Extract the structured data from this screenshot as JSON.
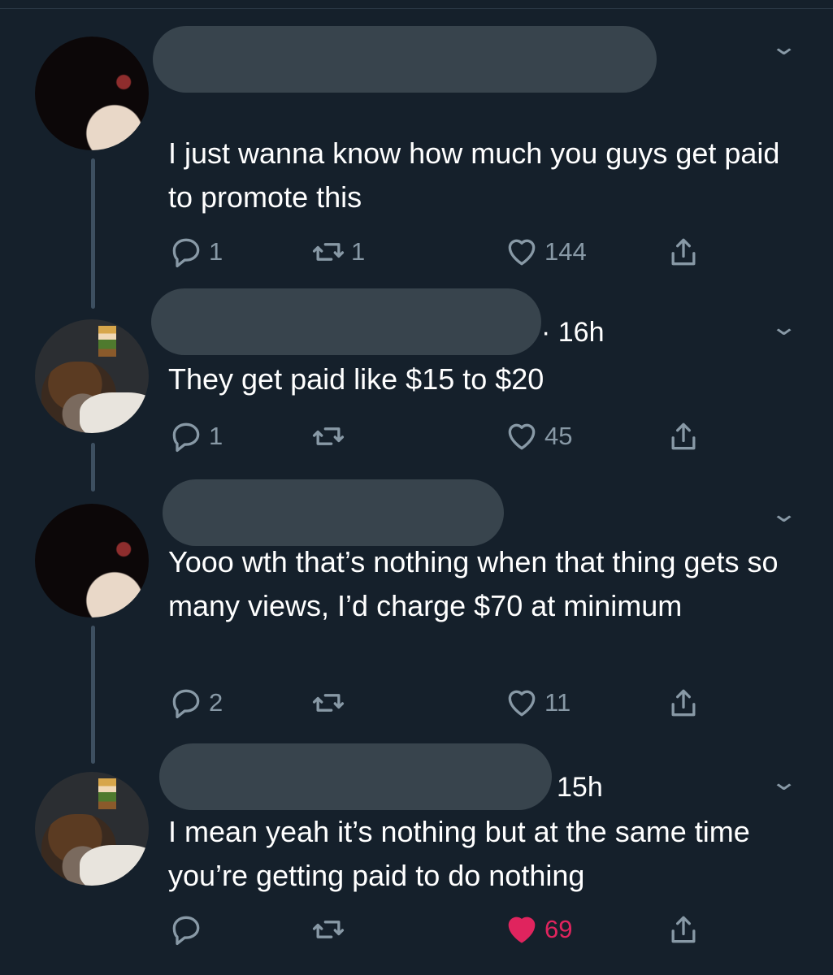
{
  "tweets": [
    {
      "time": "",
      "text": "I just wanna know how much you guys get paid to promote this",
      "replies": "1",
      "retweets": "1",
      "likes": "144",
      "liked": false
    },
    {
      "time": "· 16h",
      "text": "They get paid like $15 to $20",
      "replies": "1",
      "retweets": "",
      "likes": "45",
      "liked": false
    },
    {
      "time": "",
      "text": "Yooo wth that’s nothing when that thing gets so many views, I’d charge $70 at minimum",
      "replies": "2",
      "retweets": "",
      "likes": "11",
      "liked": false
    },
    {
      "time": "15h",
      "text": "I mean yeah it’s nothing but at the same time you’re getting paid to do nothing",
      "replies": "",
      "retweets": "",
      "likes": "69",
      "liked": true
    }
  ],
  "icons": {
    "reply": "reply-icon",
    "retweet": "retweet-icon",
    "like": "heart-icon",
    "share": "share-icon",
    "more": "chevron-down-icon"
  },
  "colors": {
    "background": "#15202b",
    "icon_gray": "#8899a6",
    "like_red": "#e0245e",
    "thread_line": "#3d4f60"
  }
}
